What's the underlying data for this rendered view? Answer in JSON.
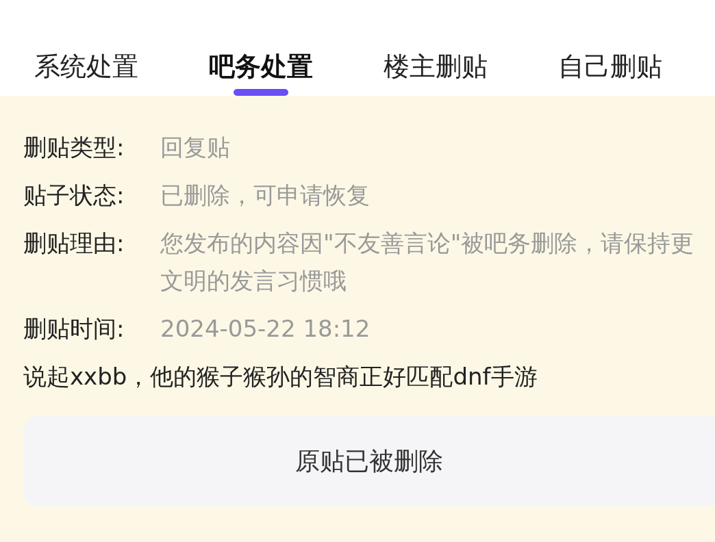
{
  "tabs": [
    {
      "label": "系统处置",
      "selected": false
    },
    {
      "label": "吧务处置",
      "selected": true
    },
    {
      "label": "楼主删贴",
      "selected": false
    },
    {
      "label": "自己删贴",
      "selected": false
    }
  ],
  "details": [
    {
      "label": "删贴类型:",
      "value": "回复贴"
    },
    {
      "label": "贴子状态:",
      "value": "已删除，可申请恢复"
    },
    {
      "label": "删贴理由:",
      "value": "您发布的内容因\"不友善言论\"被吧务删除，请保持更文明的发言习惯哦"
    },
    {
      "label": "删贴时间:",
      "value": "2024-05-22 18:12"
    }
  ],
  "post_text": "说起xxbb，他的猴子猴孙的智商正好匹配dnf手游",
  "original_post": {
    "notice": "原贴已被删除"
  }
}
